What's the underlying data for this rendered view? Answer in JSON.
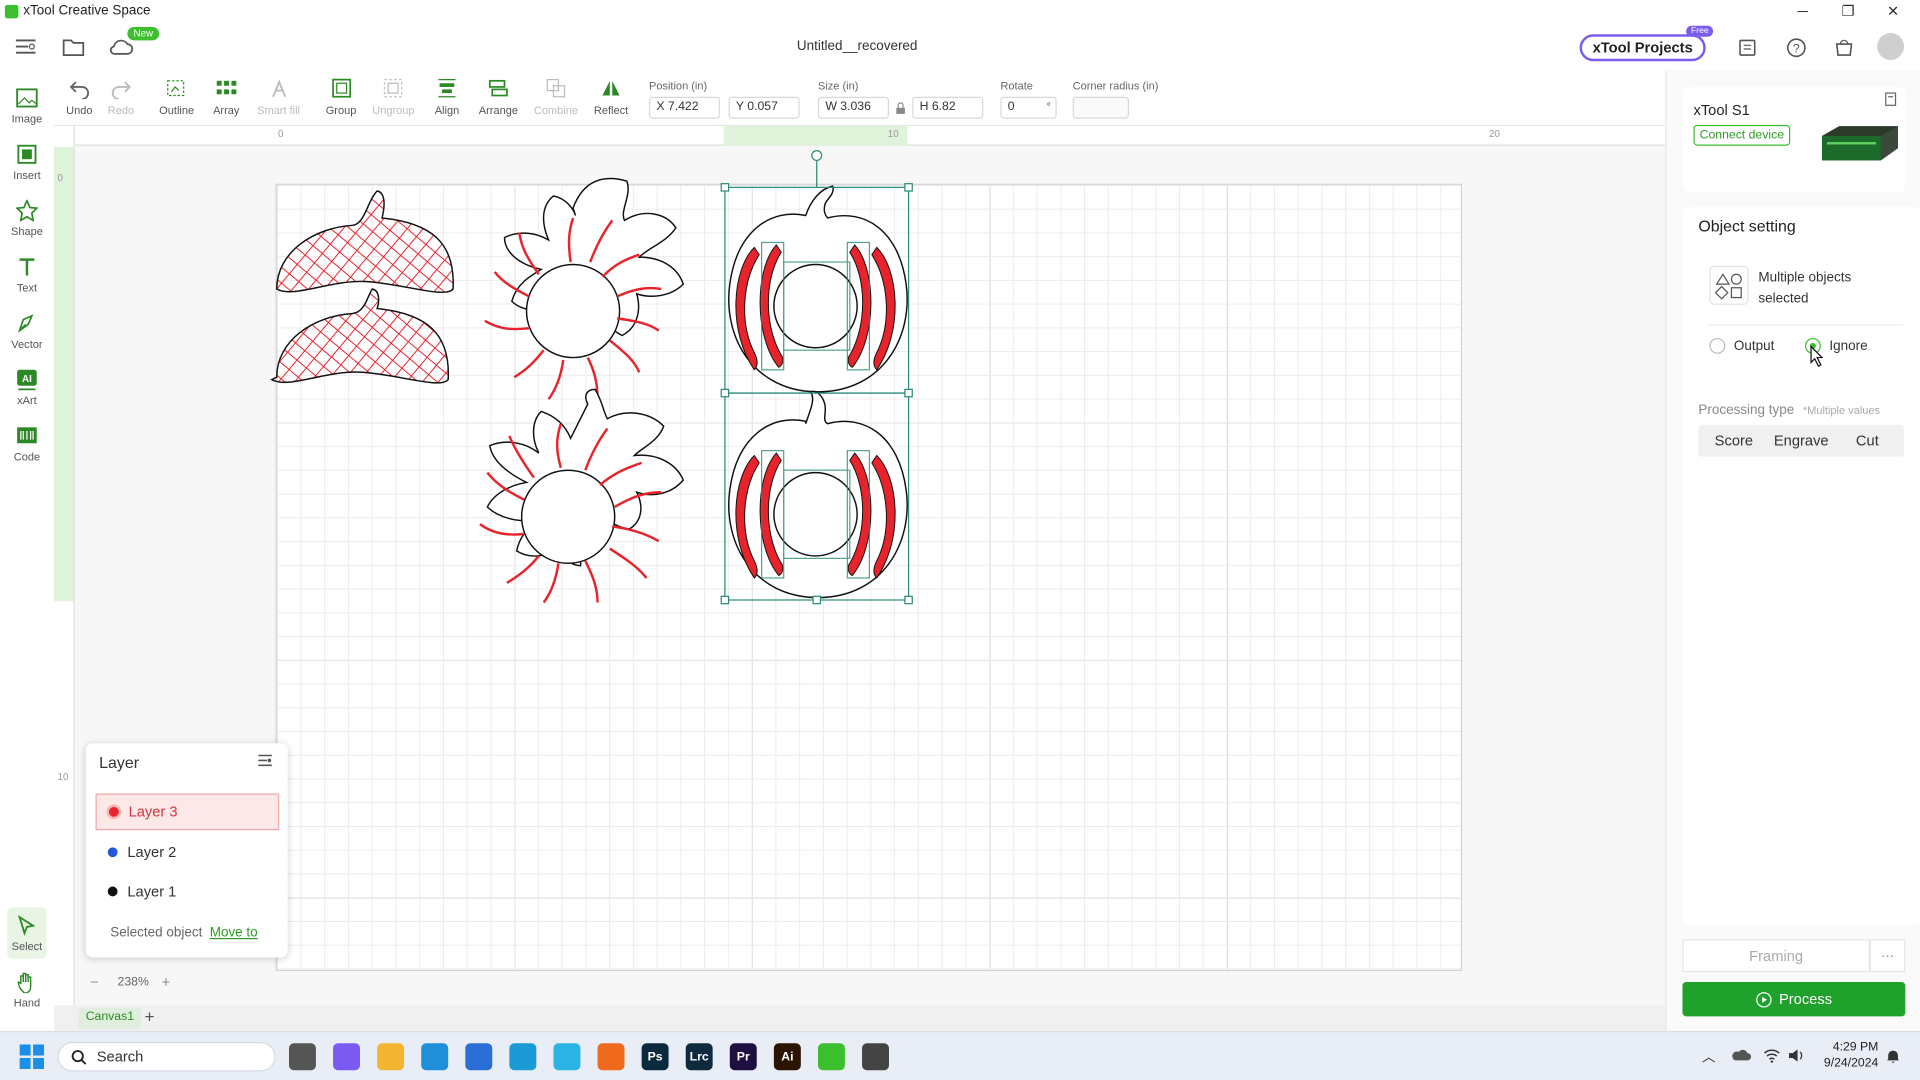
{
  "window": {
    "title": "xTool Creative Space",
    "minimize": "─",
    "restore": "❐",
    "close": "✕"
  },
  "header": {
    "doc_title": "Untitled__recovered",
    "new_badge": "New",
    "projects_label": "xTool Projects",
    "free_badge": "Free"
  },
  "left_tools": [
    {
      "label": "Image",
      "icon": "image-icon"
    },
    {
      "label": "Insert",
      "icon": "insert-icon"
    },
    {
      "label": "Shape",
      "icon": "shape-icon"
    },
    {
      "label": "Text",
      "icon": "text-icon"
    },
    {
      "label": "Vector",
      "icon": "pen-icon"
    },
    {
      "label": "xArt",
      "icon": "ai-icon"
    },
    {
      "label": "Code",
      "icon": "barcode-icon"
    },
    {
      "label": "Select",
      "icon": "cursor-icon"
    },
    {
      "label": "Hand",
      "icon": "hand-icon"
    }
  ],
  "toolbar": {
    "undo": "Undo",
    "redo": "Redo",
    "outline": "Outline",
    "array": "Array",
    "smart_fill": "Smart fill",
    "group": "Group",
    "ungroup": "Ungroup",
    "align": "Align",
    "arrange": "Arrange",
    "combine": "Combine",
    "reflect": "Reflect",
    "position_label": "Position (in)",
    "x_value": "X 7.422",
    "y_value": "Y 0.057",
    "size_label": "Size (in)",
    "w_value": "W 3.036",
    "h_value": "H 6.82",
    "rotate_label": "Rotate",
    "rotate_value": "0",
    "rotate_unit": "°",
    "corner_label": "Corner radius (in)",
    "corner_value": ""
  },
  "ruler": {
    "top_ticks": [
      "0",
      "10",
      "20"
    ],
    "left_ticks": [
      "0",
      "10"
    ]
  },
  "layer_panel": {
    "title": "Layer",
    "layers": [
      {
        "name": "Layer 3",
        "color": "#e8232b"
      },
      {
        "name": "Layer 2",
        "color": "#2456d9"
      },
      {
        "name": "Layer 1",
        "color": "#111111"
      }
    ],
    "selected_object_label": "Selected object",
    "move_to_label": "Move to"
  },
  "zoom": {
    "minus": "–",
    "value": "238%",
    "plus": "+"
  },
  "canvas_tabs": {
    "tab": "Canvas1",
    "add": "+"
  },
  "device": {
    "name": "xTool S1",
    "connect_label": "Connect device"
  },
  "object_setting": {
    "title": "Object setting",
    "multi_label": "Multiple objects selected",
    "output_label": "Output",
    "ignore_label": "Ignore",
    "processing_type_label": "Processing type",
    "multiple_values_label": "*Multiple values",
    "types": [
      "Score",
      "Engrave",
      "Cut"
    ]
  },
  "footer": {
    "framing_label": "Framing",
    "more": "···",
    "process_label": "Process"
  },
  "taskbar": {
    "search_placeholder": "Search",
    "time": "4:29 PM",
    "date": "9/24/2024",
    "apps": [
      {
        "name": "task-view",
        "label": "",
        "color": "#555555"
      },
      {
        "name": "copilot",
        "label": "",
        "color": "#7a5af0"
      },
      {
        "name": "file-explorer",
        "label": "",
        "color": "#f2b531"
      },
      {
        "name": "edge",
        "label": "",
        "color": "#1e8fd8"
      },
      {
        "name": "store",
        "label": "",
        "color": "#2a6fd6"
      },
      {
        "name": "mockup-app",
        "label": "",
        "color": "#1c9ad6"
      },
      {
        "name": "help-app",
        "label": "",
        "color": "#2bb3e6"
      },
      {
        "name": "firefox",
        "label": "",
        "color": "#f06a1d"
      },
      {
        "name": "photoshop",
        "label": "Ps",
        "color": "#0c2a3e"
      },
      {
        "name": "lightroom",
        "label": "Lrc",
        "color": "#0d2a3e"
      },
      {
        "name": "premiere",
        "label": "Pr",
        "color": "#1f0f40"
      },
      {
        "name": "illustrator",
        "label": "Ai",
        "color": "#2b1400"
      },
      {
        "name": "xtool",
        "label": "",
        "color": "#3bbf2c"
      },
      {
        "name": "chrome-like",
        "label": "",
        "color": "#444444"
      }
    ]
  }
}
